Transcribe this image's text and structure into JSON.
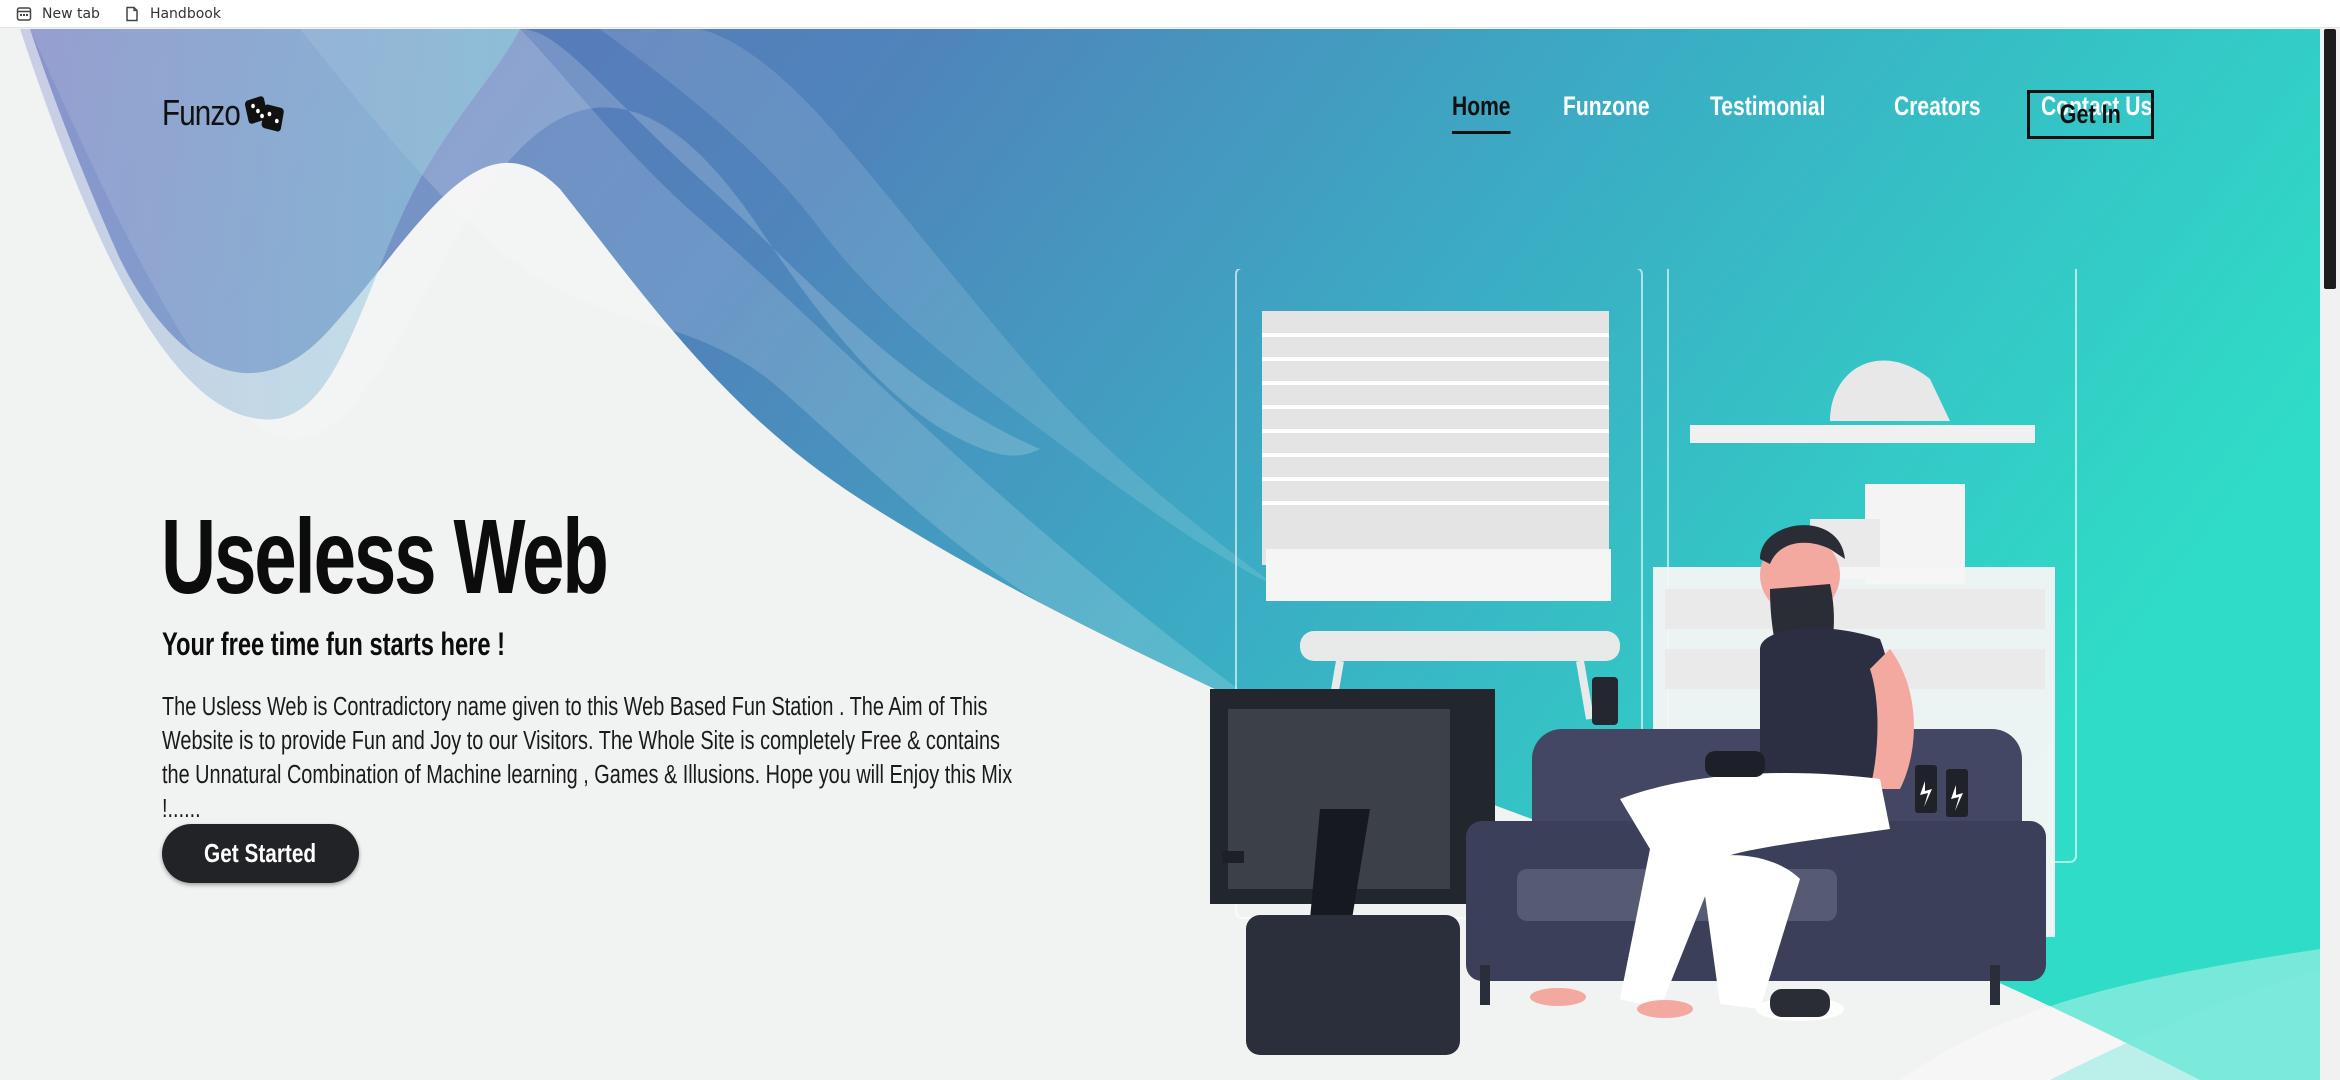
{
  "bookmarks": [
    {
      "label": "New tab",
      "icon": "new-tab-icon"
    },
    {
      "label": "Handbook",
      "icon": "document-icon"
    }
  ],
  "header": {
    "logo_text": "Funzo",
    "logo_icon": "dice-icon",
    "nav": [
      "Home",
      "Funzone",
      "Testimonial",
      "Creators",
      "Contact Us"
    ],
    "active_nav": "Home",
    "cta_label": "Get In"
  },
  "hero": {
    "title": "Useless Web",
    "subtitle": "Your free time fun starts here !",
    "description": "The Usless Web is Contradictory name given to this Web Based Fun Station . The Aim of This Website is to provide Fun and Joy to our Visitors. The Whole Site is completely Free & contains the Unnatural Combination of Machine learning , Games & Illusions. Hope you will Enjoy this Mix !......",
    "button_label": "Get Started",
    "illustration": "man-playing-video-game-illustration"
  },
  "colors": {
    "gradient_start": "#5b6bb4",
    "gradient_end": "#2fdcc7",
    "text_dark": "#0c0c0c",
    "button_dark": "#222326",
    "background": "#f1f2f2"
  }
}
